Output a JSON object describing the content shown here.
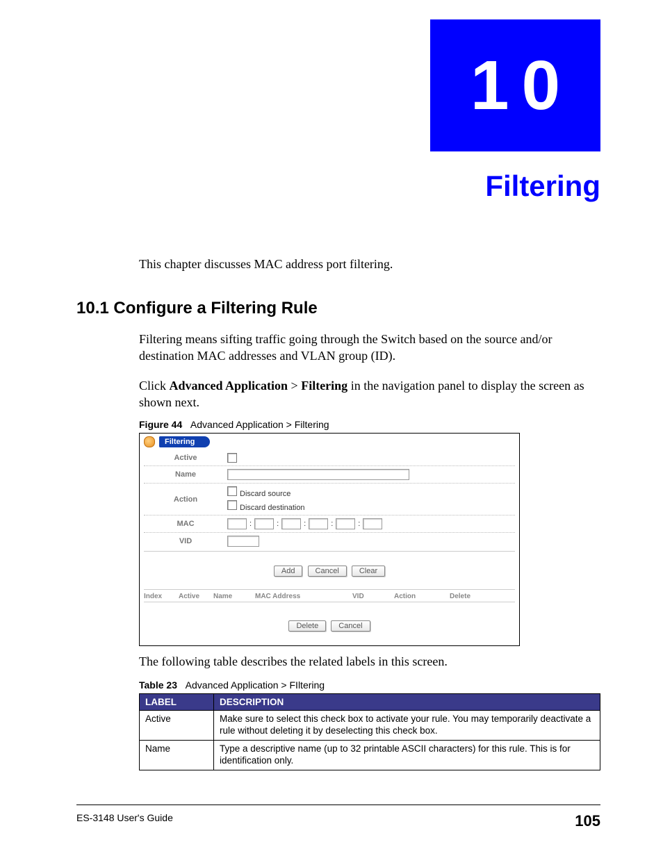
{
  "chapter": {
    "number": "10",
    "title": "Filtering"
  },
  "intro": "This chapter discusses MAC address port filtering.",
  "section": {
    "heading": "10.1  Configure a Filtering Rule",
    "para1": "Filtering means sifting traffic going through the Switch based on the source and/or destination MAC addresses and VLAN group (ID).",
    "para2_prefix": "Click ",
    "para2_b1": "Advanced Application",
    "para2_sep": " > ",
    "para2_b2": "Filtering",
    "para2_suffix": " in the navigation panel to display the screen as shown next."
  },
  "figure": {
    "label": "Figure 44",
    "caption": "Advanced Application > Filtering",
    "panel_title": "Filtering",
    "rows": {
      "active": "Active",
      "name": "Name",
      "action": "Action",
      "action_opt1": "Discard source",
      "action_opt2": "Discard destination",
      "mac": "MAC",
      "vid": "VID"
    },
    "buttons": {
      "add": "Add",
      "cancel": "Cancel",
      "clear": "Clear",
      "delete": "Delete"
    },
    "list_headers": {
      "index": "Index",
      "active": "Active",
      "name": "Name",
      "mac": "MAC Address",
      "vid": "VID",
      "action": "Action",
      "delete": "Delete"
    }
  },
  "post_figure_para": "The following table describes the related labels in this screen.",
  "table": {
    "label": "Table 23",
    "caption": "Advanced Application > FIltering",
    "headers": {
      "label": "LABEL",
      "description": "DESCRIPTION"
    },
    "rows": [
      {
        "label": "Active",
        "desc": "Make sure to select this check box to activate your rule. You may temporarily deactivate a rule without deleting it by deselecting this check box."
      },
      {
        "label": "Name",
        "desc": "Type a descriptive name (up to 32 printable ASCII characters) for this rule. This is for identification only."
      }
    ]
  },
  "footer": {
    "guide": "ES-3148 User's Guide",
    "page": "105"
  }
}
